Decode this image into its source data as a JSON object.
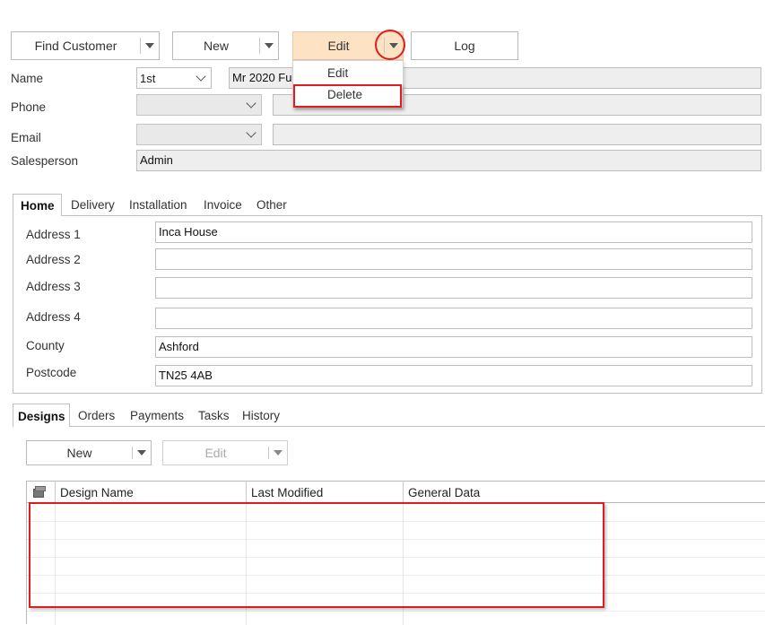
{
  "toolbar": {
    "find_customer": "Find Customer",
    "new": "New",
    "edit": "Edit",
    "log": "Log"
  },
  "edit_menu": {
    "items": [
      "Edit",
      "Delete"
    ]
  },
  "form": {
    "name_label": "Name",
    "name_position": "1st",
    "name_value": "Mr 2020 Fus",
    "phone_label": "Phone",
    "phone_type": "",
    "phone_value": "",
    "email_label": "Email",
    "email_type": "",
    "email_value": "",
    "salesperson_label": "Salesperson",
    "salesperson_value": "Admin"
  },
  "address_tabs": [
    "Home",
    "Delivery",
    "Installation",
    "Invoice",
    "Other"
  ],
  "address": {
    "address1_label": "Address 1",
    "address1_value": "Inca House",
    "address2_label": "Address 2",
    "address2_value": "",
    "address3_label": "Address 3",
    "address3_value": "",
    "address4_label": "Address 4",
    "address4_value": "",
    "county_label": "County",
    "county_value": "Ashford",
    "postcode_label": "Postcode",
    "postcode_value": "TN25 4AB"
  },
  "bottom_tabs": [
    "Designs",
    "Orders",
    "Payments",
    "Tasks",
    "History"
  ],
  "designs": {
    "new_label": "New",
    "edit_label": "Edit",
    "columns": [
      "Design Name",
      "Last Modified",
      "General Data"
    ],
    "rows": []
  },
  "annotation_color": "#e31b1b",
  "accent_color": "#fde2c4"
}
